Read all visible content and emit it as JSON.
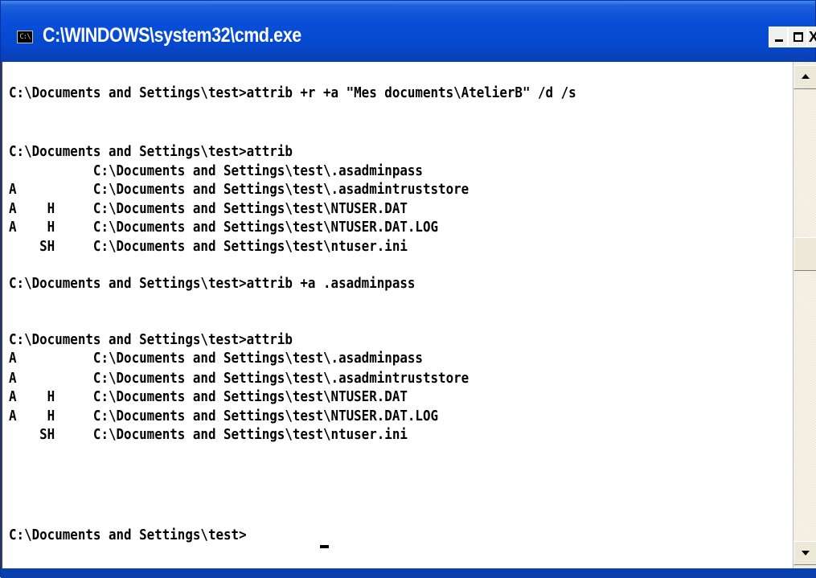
{
  "window": {
    "title": "C:\\WINDOWS\\system32\\cmd.exe",
    "icon_name": "console-icon",
    "icon_text": "C:\\",
    "buttons": {
      "minimize": "minimize-button",
      "maximize": "maximize-button",
      "close_glyph": "X"
    }
  },
  "console": {
    "lines": [
      "C:\\Documents and Settings\\test>attrib +r +a \"Mes documents\\AtelierB\" /d /s",
      "",
      "C:\\Documents and Settings\\test>attrib",
      "           C:\\Documents and Settings\\test\\.asadminpass",
      "A          C:\\Documents and Settings\\test\\.asadmintruststore",
      "A    H     C:\\Documents and Settings\\test\\NTUSER.DAT",
      "A    H     C:\\Documents and Settings\\test\\NTUSER.DAT.LOG",
      "    SH     C:\\Documents and Settings\\test\\ntuser.ini",
      "",
      "C:\\Documents and Settings\\test>attrib +a .asadminpass",
      "",
      "C:\\Documents and Settings\\test>attrib",
      "A          C:\\Documents and Settings\\test\\.asadminpass",
      "A          C:\\Documents and Settings\\test\\.asadmintruststore",
      "A    H     C:\\Documents and Settings\\test\\NTUSER.DAT",
      "A    H     C:\\Documents and Settings\\test\\NTUSER.DAT.LOG",
      "    SH     C:\\Documents and Settings\\test\\ntuser.ini",
      "",
      "C:\\Documents and Settings\\test>"
    ]
  },
  "colors": {
    "titlebar": "#0a50d8",
    "console_bg": "#ffffff",
    "console_text": "#000000"
  }
}
